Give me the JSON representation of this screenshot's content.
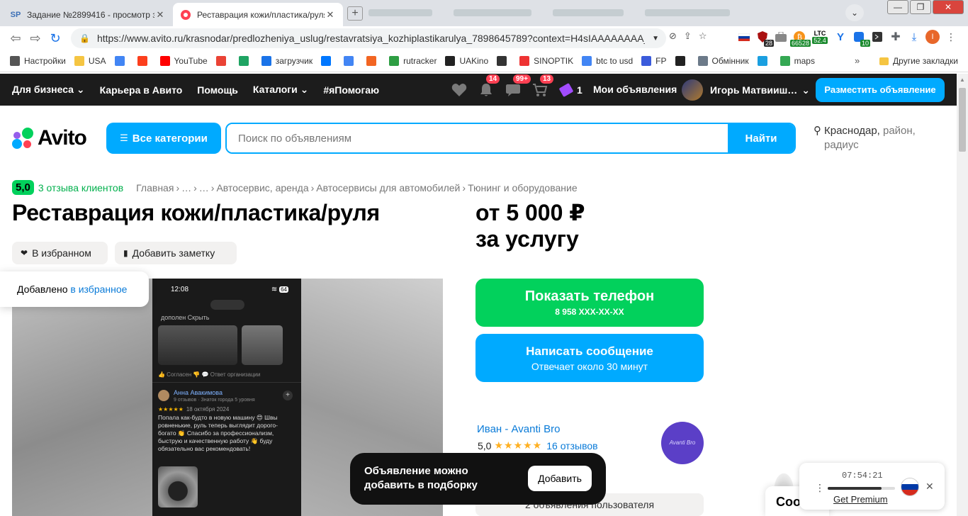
{
  "browser": {
    "tabs": [
      {
        "favicon": "SP",
        "title": "Задание №2899416 - просмотр з",
        "active": false
      },
      {
        "favicon": "avito-favicon",
        "title": "Реставрация кожи/пластика/руля",
        "active": true
      }
    ],
    "url": "https://www.avito.ru/krasnodar/predlozheniya_uslug/restavratsiya_kozhiplastikarulya_7898645789?context=H4sIAAAAAAAA_w...",
    "extensions": [
      {
        "name": "russia-flag-icon",
        "badge": ""
      },
      {
        "name": "shield-extension-icon",
        "badge": "28"
      },
      {
        "name": "briefcase-extension-icon",
        "badge": ""
      },
      {
        "name": "bitcoin-icon",
        "badge": "66528"
      },
      {
        "name": "litecoin-icon",
        "label": "LTC",
        "badge": "52.4"
      },
      {
        "name": "v-extension-icon",
        "badge": ""
      },
      {
        "name": "blue-extension-icon",
        "badge": "10"
      },
      {
        "name": "terminal-extension-icon",
        "badge": ""
      },
      {
        "name": "puzzle-icon",
        "badge": ""
      },
      {
        "name": "download-icon",
        "badge": ""
      }
    ],
    "profile_initial": "I",
    "bookmarks": [
      {
        "icon": "gear-icon",
        "label": "Настройки",
        "color": "#555555"
      },
      {
        "icon": "folder-icon",
        "label": "USA",
        "color": "#f5c542"
      },
      {
        "icon": "google-icon",
        "label": "",
        "color": "#4285f4"
      },
      {
        "icon": "yandex-icon",
        "label": "",
        "color": "#fc3f1d"
      },
      {
        "icon": "youtube-icon",
        "label": "YouTube",
        "color": "#ff0000"
      },
      {
        "icon": "gmail-icon",
        "label": "",
        "color": "#ea4335"
      },
      {
        "icon": "drive-icon",
        "label": "",
        "color": "#1fa463"
      },
      {
        "icon": "infinity-icon",
        "label": "загрузчик",
        "color": "#1a73e8"
      },
      {
        "icon": "vk-icon",
        "label": "",
        "color": "#0077ff"
      },
      {
        "icon": "translate-icon",
        "label": "",
        "color": "#4285f4"
      },
      {
        "icon": "f-icon",
        "label": "",
        "color": "#f26522"
      },
      {
        "icon": "rutracker-icon",
        "label": "rutracker",
        "color": "#2e9e43"
      },
      {
        "icon": "uakino-icon",
        "label": "UAKino",
        "color": "#222222"
      },
      {
        "icon": "chess-icon",
        "label": "",
        "color": "#333333"
      },
      {
        "icon": "thermometer-icon",
        "label": "SINOPTIK",
        "color": "#e33"
      },
      {
        "icon": "google-icon",
        "label": "btc to usd",
        "color": "#4285f4"
      },
      {
        "icon": "fp-icon",
        "label": "FP",
        "color": "#3b5bdb"
      },
      {
        "icon": "bc-icon",
        "label": "",
        "color": "#222222"
      },
      {
        "icon": "exchange-icon",
        "label": "Обмінник",
        "color": "#6c7a89"
      },
      {
        "icon": "star-icon",
        "label": "",
        "color": "#1a9fe0"
      },
      {
        "icon": "maps-icon",
        "label": "maps",
        "color": "#34a853"
      }
    ],
    "other_bookmarks": "Другие закладки"
  },
  "header": {
    "nav": [
      {
        "label": "Для бизнеса",
        "dropdown": true
      },
      {
        "label": "Карьера в Авито",
        "dropdown": false
      },
      {
        "label": "Помощь",
        "dropdown": false
      },
      {
        "label": "Каталоги",
        "dropdown": true
      },
      {
        "label": "#яПомогаю",
        "dropdown": false
      }
    ],
    "favorites_count": "",
    "notifications_count": "14",
    "messages_count": "99+",
    "cart_count": "13",
    "tickets_count": "1",
    "my_ads": "Мои объявления",
    "user_name": "Игорь Матвииш…",
    "post_ad": "Разместить объявление"
  },
  "search": {
    "logo": "Avito",
    "all_categories": "Все категории",
    "placeholder": "Поиск по объявлениям",
    "submit": "Найти",
    "location_city": "Краснодар,",
    "location_rest": " район,",
    "location_line2": "радиус"
  },
  "listing": {
    "rating": "5,0",
    "reviews_label": "3 отзыва клиентов",
    "breadcrumbs": [
      "Главная",
      "…",
      "…",
      "Автосервис, аренда",
      "Автосервисы для автомобилей",
      "Тюнинг и оборудование"
    ],
    "title": "Реставрация кожи/пластика/руля",
    "price_line1": "от 5 000 ₽",
    "price_line2": "за услугу",
    "favorite_button": "В избранном",
    "note_button": "Добавить заметку",
    "tooltip_prefix": "Добавлено ",
    "tooltip_link": "в избранное"
  },
  "phone_screenshot": {
    "time": "12:08",
    "battery": "64",
    "top_text": "дополен Скрыть",
    "meta": "👍 Согласен    👎    💬 Ответ организации",
    "reviewer": "Анна Авакимова",
    "reviewer_sub": "9 отзывов · Знаток города 5 уровня",
    "stars": "★★★★★",
    "date": "18 октября 2024",
    "text": "Попала как-будто в новую машину 😍 Швы ровненькие, руль теперь выглядит дорого-богато 👏 Спасибо за профессионализм, быструю и качественную работу 👋 буду обязательно вас рекомендовать!"
  },
  "contact": {
    "show_phone": "Показать телефон",
    "phone_masked": "8 958 XXX-XX-XX",
    "write_message": "Написать сообщение",
    "reply_time": "Отвечает около 30 минут"
  },
  "seller": {
    "name": "Иван - Avanti Bro",
    "rating": "5,0",
    "stars": "★★★★★",
    "reviews": "16 отзывов",
    "avatar_text": "Avanti Bro",
    "other_ads": "2 объявления пользователя"
  },
  "toast": {
    "message": "Объявление можно добавить в подборку",
    "action": "Добавить"
  },
  "cookie_label": "Coo",
  "timer_widget": {
    "time": "07:54:21",
    "progress": 0.8,
    "link": "Get Premium"
  },
  "colors": {
    "avito_blue": "#00aaff",
    "avito_green": "#02d15c",
    "dark_header": "#1c1c1c",
    "badge_red": "#ff4053"
  }
}
